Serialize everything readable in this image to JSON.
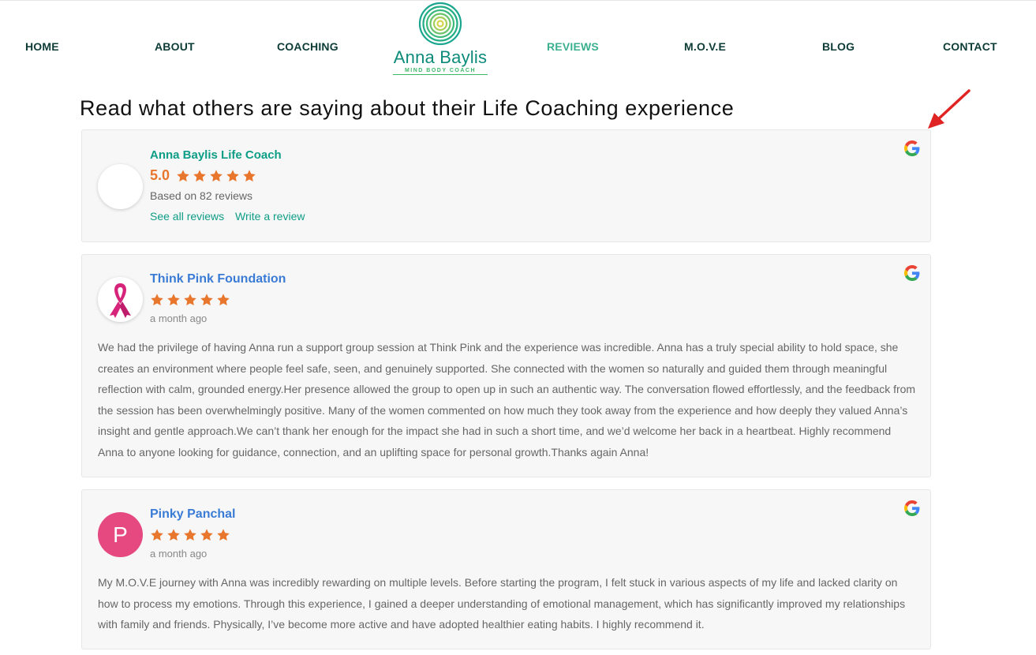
{
  "nav": {
    "items": [
      {
        "label": "HOME"
      },
      {
        "label": "ABOUT"
      },
      {
        "label": "COACHING"
      },
      {
        "label": "REVIEWS"
      },
      {
        "label": "M.O.V.E"
      },
      {
        "label": "BLOG"
      },
      {
        "label": "CONTACT"
      }
    ],
    "active": "REVIEWS",
    "logo": {
      "name": "Anna Baylis",
      "tagline": "MIND BODY COACH"
    }
  },
  "headline": "Read what others are saying about their Life Coaching experience",
  "summary": {
    "business_name": "Anna Baylis Life Coach",
    "rating": "5.0",
    "stars": 5,
    "based_on": "Based on 82 reviews",
    "see_all": "See all reviews",
    "write": "Write a review"
  },
  "reviews": [
    {
      "name": "Think Pink Foundation",
      "stars": 5,
      "time": "a month ago",
      "avatar_icon": "pink-ribbon-icon",
      "text": "We had the privilege of having Anna run a support group session at Think Pink and the experience was incredible. Anna has a truly special ability to hold space, she creates an environment where people feel safe, seen, and genuinely supported. She connected with the women so naturally and guided them through meaningful reflection with calm, grounded energy.Her presence allowed the group to open up in such an authentic way. The conversation flowed effortlessly, and the feedback from the session has been overwhelmingly positive. Many of the women commented on how much they took away from the experience and how deeply they valued Anna’s insight and gentle approach.We can’t thank her enough for the impact she had in such a short time, and we’d welcome her back in a heartbeat. Highly recommend Anna to anyone looking for guidance, connection, and an uplifting space for personal growth.Thanks again Anna!"
    },
    {
      "name": "Pinky Panchal",
      "stars": 5,
      "time": "a month ago",
      "avatar_letter": "P",
      "text": "My M.O.V.E journey with Anna was incredibly rewarding on multiple levels. Before starting the program, I felt stuck in various aspects of my life and lacked clarity on how to process my emotions. Through this experience, I gained a deeper understanding of emotional management, which has significantly improved my relationships with family and friends. Physically, I’ve become more active and have adopted healthier eating habits. I highly recommend it."
    }
  ],
  "colors": {
    "nav_text": "#0d3b36",
    "nav_active": "#3bb08f",
    "brand_teal": "#0e9d86",
    "star_orange": "#e8762c",
    "reviewer_blue": "#3a7bd5",
    "avatar_pink": "#e64980",
    "arrow_red": "#e02424"
  }
}
